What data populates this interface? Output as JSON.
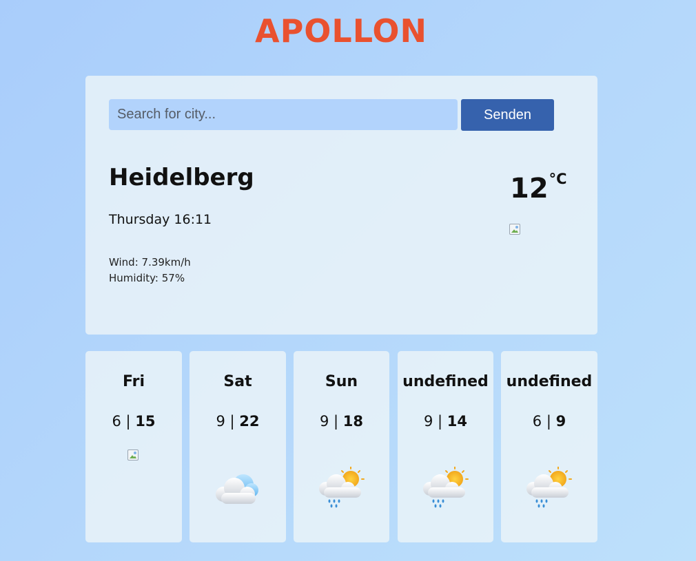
{
  "app": {
    "title": "APOLLON"
  },
  "search": {
    "placeholder": "Search for city...",
    "value": "",
    "button_label": "Senden"
  },
  "current": {
    "city": "Heidelberg",
    "datetime": "Thursday 16:11",
    "wind": "Wind: 7.39km/h",
    "humidity": "Humidity: 57%",
    "temperature": "12",
    "unit": "°C",
    "icon": "broken-image-icon"
  },
  "forecast": [
    {
      "day": "Fri",
      "min": "6",
      "separator": "|",
      "max": "15",
      "icon": "broken-image-icon"
    },
    {
      "day": "Sat",
      "min": "9",
      "separator": "|",
      "max": "22",
      "icon": "cloud-icon"
    },
    {
      "day": "Sun",
      "min": "9",
      "separator": "|",
      "max": "18",
      "icon": "sun-cloud-rain-icon"
    },
    {
      "day": "undefined",
      "min": "9",
      "separator": "|",
      "max": "14",
      "icon": "sun-cloud-rain-icon"
    },
    {
      "day": "undefined",
      "min": "6",
      "separator": "|",
      "max": "9",
      "icon": "sun-cloud-rain-icon"
    }
  ],
  "colors": {
    "title": "#e9512f",
    "button": "#3662ad",
    "input_bg": "#b2d3fc",
    "card_bg": "#e8f2f7"
  }
}
